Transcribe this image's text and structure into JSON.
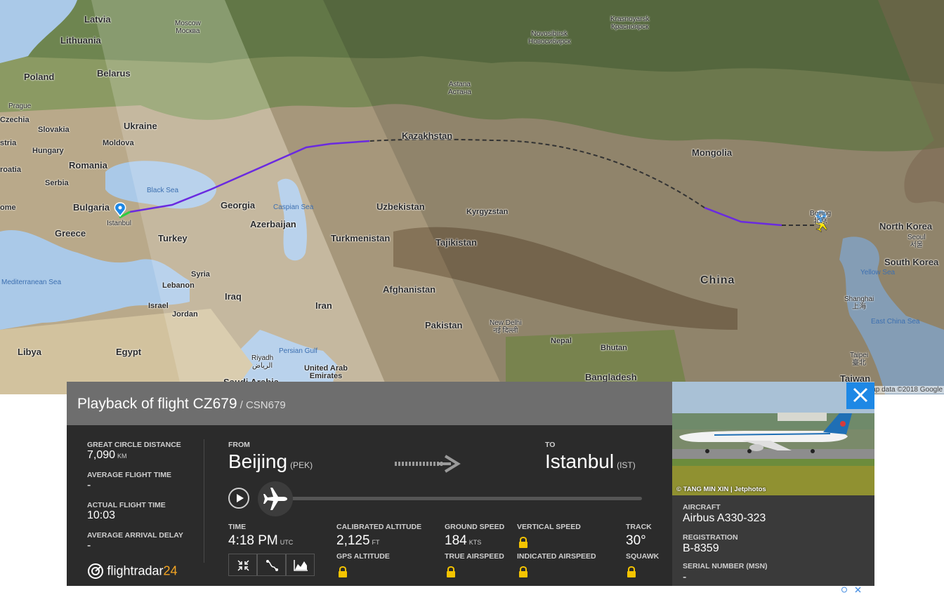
{
  "map": {
    "countries": [
      {
        "name": "Latvia"
      },
      {
        "name": "Lithuania"
      },
      {
        "name": "Poland"
      },
      {
        "name": "Belarus"
      },
      {
        "name": "Ukraine"
      },
      {
        "name": "Czechia"
      },
      {
        "name": "Slovakia"
      },
      {
        "name": "Hungary"
      },
      {
        "name": "Moldova"
      },
      {
        "name": "Romania"
      },
      {
        "name": "Serbia"
      },
      {
        "name": "Bulgaria"
      },
      {
        "name": "Greece"
      },
      {
        "name": "Turkey"
      },
      {
        "name": "Georgia"
      },
      {
        "name": "Azerbaijan"
      },
      {
        "name": "Kazakhstan"
      },
      {
        "name": "Uzbekistan"
      },
      {
        "name": "Turkmenistan"
      },
      {
        "name": "Kyrgyzstan"
      },
      {
        "name": "Tajikistan"
      },
      {
        "name": "Afghanistan"
      },
      {
        "name": "Iran"
      },
      {
        "name": "Iraq"
      },
      {
        "name": "Syria"
      },
      {
        "name": "Lebanon"
      },
      {
        "name": "Israel"
      },
      {
        "name": "Jordan"
      },
      {
        "name": "Libya"
      },
      {
        "name": "Egypt"
      },
      {
        "name": "Saudi Arabia"
      },
      {
        "name": "United Arab Emirates"
      },
      {
        "name": "Pakistan"
      },
      {
        "name": "Nepal"
      },
      {
        "name": "Bhutan"
      },
      {
        "name": "Bangladesh"
      },
      {
        "name": "Mongolia"
      },
      {
        "name": "China"
      },
      {
        "name": "North Korea"
      },
      {
        "name": "South Korea"
      },
      {
        "name": "Taiwan"
      },
      {
        "name": "stria"
      },
      {
        "name": "roatia"
      },
      {
        "name": "ome"
      }
    ],
    "cities": [
      {
        "name": "Moscow",
        "local": "Москва"
      },
      {
        "name": "Prague",
        "local": ""
      },
      {
        "name": "Istanbul",
        "local": ""
      },
      {
        "name": "Astana",
        "local": "Астана"
      },
      {
        "name": "Novosibirsk",
        "local": "Новосибирск"
      },
      {
        "name": "Krasnoyarsk",
        "local": "Красноярск"
      },
      {
        "name": "New Delhi",
        "local": "नई दिल्ली"
      },
      {
        "name": "Riyadh",
        "local": "الرياض"
      },
      {
        "name": "Beijing",
        "local": "北京"
      },
      {
        "name": "Seoul",
        "local": "서울"
      },
      {
        "name": "Shanghai",
        "local": "上海"
      },
      {
        "name": "Taipei",
        "local": "臺北"
      }
    ],
    "seas": [
      "Black Sea",
      "Caspian Sea",
      "Mediterranean Sea",
      "Persian Gulf",
      "Yellow Sea",
      "East China Sea"
    ],
    "credit": "ap data ©2018 Google"
  },
  "panel": {
    "title": "Playback of flight CZ679",
    "callsign": "/ CSN679",
    "great_circle_label": "GREAT CIRCLE DISTANCE",
    "great_circle_value": "7,090",
    "great_circle_unit": "KM",
    "avg_flight_time_label": "AVERAGE FLIGHT TIME",
    "avg_flight_time_value": "-",
    "actual_flight_time_label": "ACTUAL FLIGHT TIME",
    "actual_flight_time_value": "10:03",
    "avg_arrival_delay_label": "AVERAGE ARRIVAL DELAY",
    "avg_arrival_delay_value": "-",
    "logo_text": "flightradar",
    "logo_suffix": "24",
    "from_label": "FROM",
    "from_city": "Beijing",
    "from_code": "(PEK)",
    "to_label": "TO",
    "to_city": "Istanbul",
    "to_code": "(IST)",
    "playback_progress": 0.0,
    "time_label": "TIME",
    "time_value": "4:18 PM",
    "time_unit": "UTC",
    "cal_alt_label": "CALIBRATED ALTITUDE",
    "cal_alt_value": "2,125",
    "cal_alt_unit": "FT",
    "gps_alt_label": "GPS ALTITUDE",
    "ground_speed_label": "GROUND SPEED",
    "ground_speed_value": "184",
    "ground_speed_unit": "KTS",
    "true_airspeed_label": "TRUE AIRSPEED",
    "vertical_speed_label": "VERTICAL SPEED",
    "indicated_airspeed_label": "INDICATED AIRSPEED",
    "track_label": "TRACK",
    "track_value": "30°",
    "squawk_label": "SQUAWK"
  },
  "aircraft": {
    "photo_credit": "© TANG MIN XIN | Jetphotos",
    "aircraft_label": "AIRCRAFT",
    "aircraft_value": "Airbus A330-323",
    "registration_label": "REGISTRATION",
    "registration_value": "B-8359",
    "serial_label": "SERIAL NUMBER (MSN)",
    "serial_value": "-"
  },
  "colors": {
    "track": "#6a2ae0",
    "close": "#1e88e5",
    "logo_accent": "#f5a623"
  }
}
